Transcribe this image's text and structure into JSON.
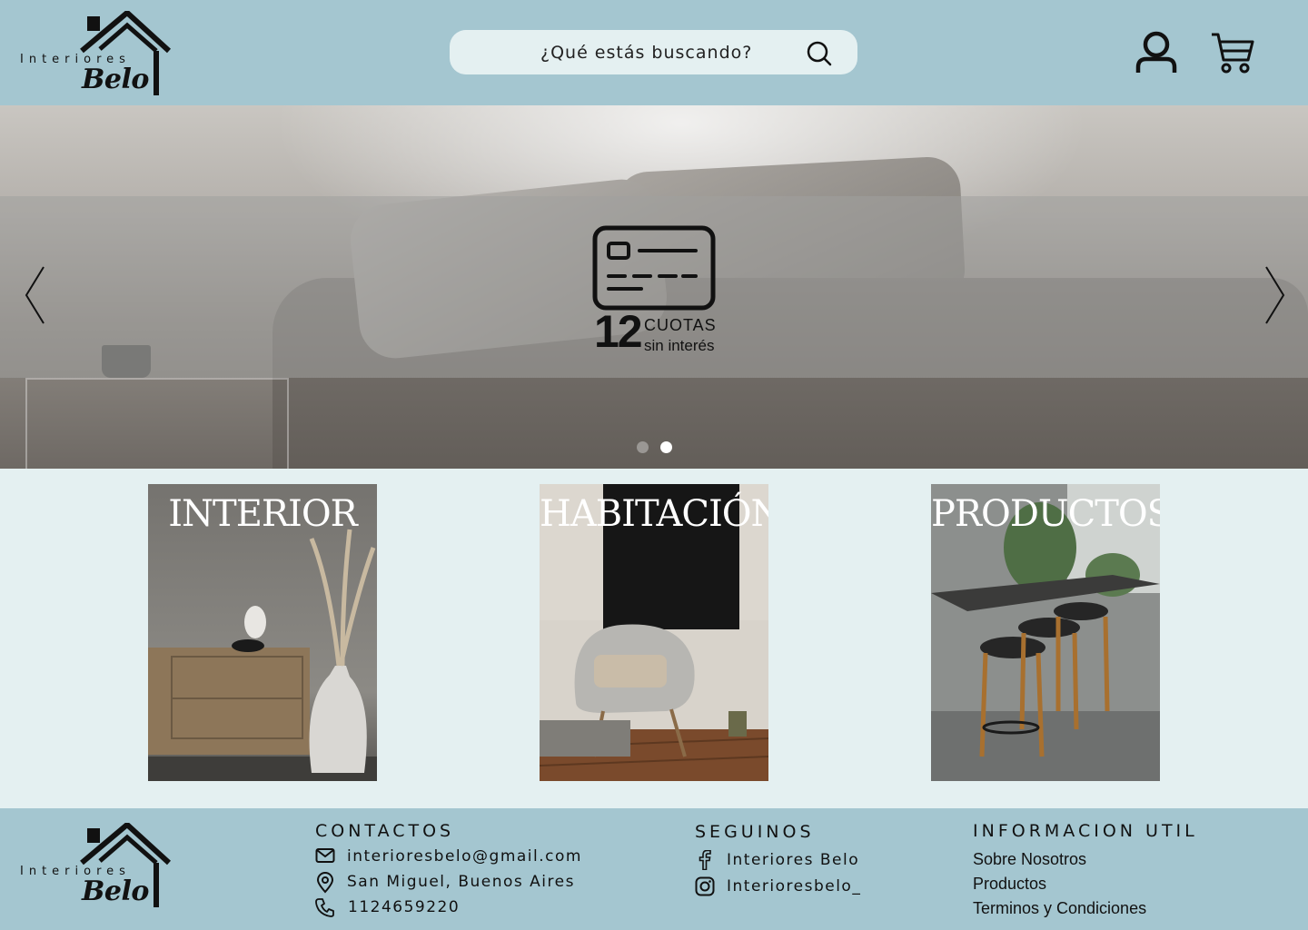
{
  "brand": {
    "small": "Interiores",
    "big": "Belo"
  },
  "search": {
    "placeholder": "¿Qué estás buscando?"
  },
  "header": {
    "icons": [
      "search-icon",
      "user-icon",
      "cart-icon"
    ]
  },
  "hero": {
    "promo": {
      "number": "12",
      "line1": "CUOTAS",
      "line2": "sin interés"
    },
    "slides_total": 2,
    "active_slide": 2
  },
  "categories": [
    {
      "title": "INTERIOR"
    },
    {
      "title": "HABITACIÓN"
    },
    {
      "title": "PRODUCTOS"
    }
  ],
  "footer": {
    "contacts": {
      "heading": "CONTACTOS",
      "email": "interioresbelo@gmail.com",
      "address": "San Miguel, Buenos Aires",
      "phone": "1124659220"
    },
    "social": {
      "heading": "SEGUINOS",
      "facebook": "Interiores Belo",
      "instagram": "Interioresbelo_"
    },
    "info": {
      "heading": "INFORMACION UTIL",
      "links": [
        "Sobre Nosotros",
        "Productos",
        "Terminos y Condiciones"
      ]
    }
  },
  "colors": {
    "header_bg": "#a4c6d0",
    "page_bg": "#e4f0f1",
    "search_bg": "#e4f0f1"
  }
}
